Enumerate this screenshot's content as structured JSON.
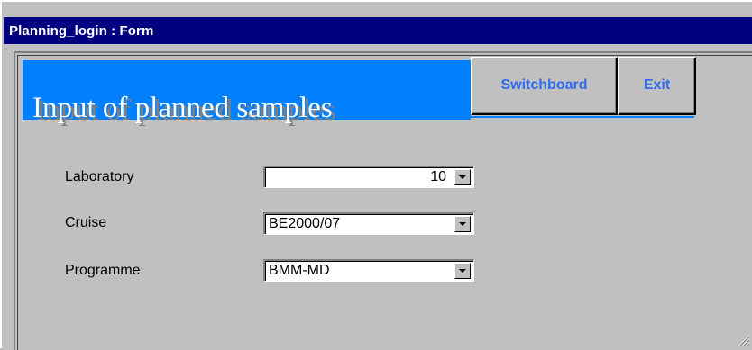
{
  "window": {
    "title": "Planning_login : Form"
  },
  "banner": {
    "title": "Input of planned samples"
  },
  "buttons": {
    "switchboard": "Switchboard",
    "exit": "Exit"
  },
  "form": {
    "laboratory": {
      "label": "Laboratory",
      "value": "10"
    },
    "cruise": {
      "label": "Cruise",
      "value": "BE2000/07"
    },
    "programme": {
      "label": "Programme",
      "value": "BMM-MD"
    }
  },
  "colors": {
    "titlebar": "#000080",
    "banner": "#0080ff",
    "button_text": "#2f6bf0"
  }
}
